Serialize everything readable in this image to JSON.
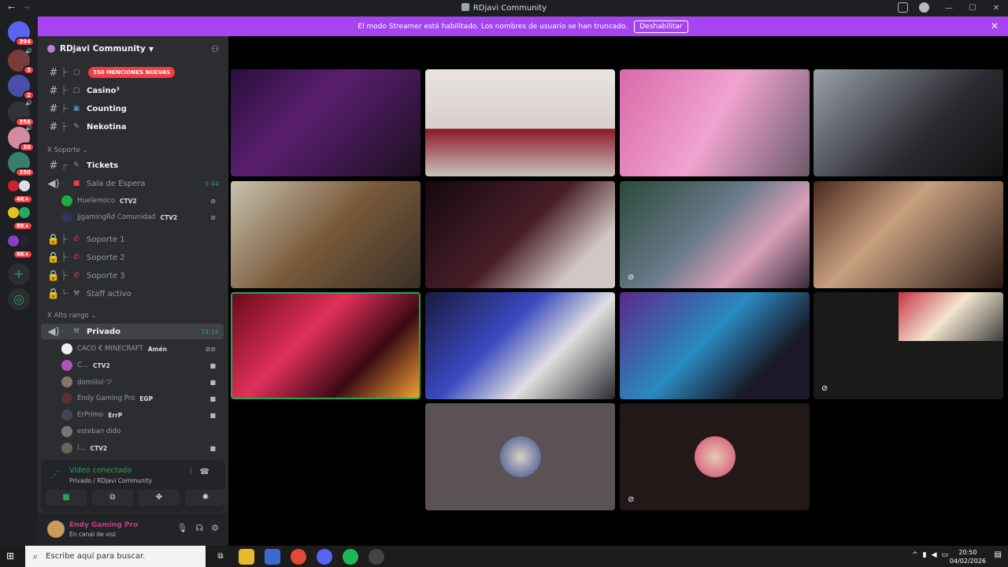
{
  "window": {
    "title": "RDjavi Community"
  },
  "banner": {
    "message": "El modo Streamer está habilitado. Los nombres de usuario se han truncado.",
    "button": "Deshabilitar"
  },
  "servers": {
    "home_badge": "394",
    "items": [
      {
        "badge": "3"
      },
      {
        "badge": "2"
      },
      {
        "badge": "356"
      },
      {
        "badge": "30"
      },
      {
        "badge": "350"
      },
      {
        "badge": "4K+"
      },
      {
        "badge": "8K+"
      },
      {
        "badge": "9K+"
      }
    ]
  },
  "sidebar": {
    "server_name": "RDjavi Community",
    "mentions_pill": "350 MENCIONES NUEVAS",
    "channels": {
      "casino": "Casino³",
      "counting": "Counting",
      "nekotina": "Nekotina",
      "tickets": "Tickets",
      "sala_espera": "Sala de Espera",
      "sala_espera_time": "5:44",
      "soporte1": "Soporte 1",
      "soporte2": "Soporte 2",
      "soporte3": "Soporte 3",
      "staff": "Staff activo",
      "privado": "Privado",
      "privado_time": "14:16"
    },
    "categories": {
      "soporte": "X Soporte",
      "alto": "X Alto rango"
    },
    "sala_users": [
      {
        "name": "Huelemoco",
        "tag": "CTV2"
      },
      {
        "name": "JjgamingRd Comunidad",
        "tag": "CTV2"
      }
    ],
    "privado_users": [
      {
        "name": "CACO € MINECRAFT",
        "tag": "Amén"
      },
      {
        "name": "C...",
        "tag": "CTV2"
      },
      {
        "name": "domiilol·ツ",
        "tag": ""
      },
      {
        "name": "Endy Gaming Pro",
        "tag": "EGP"
      },
      {
        "name": "ErPrimo",
        "tag": "ErrP"
      },
      {
        "name": "esteban dido",
        "tag": ""
      },
      {
        "name": "l...",
        "tag": "CTV2"
      }
    ]
  },
  "voice": {
    "status": "Video conectado",
    "location": "Privado / RDjavi Community"
  },
  "user": {
    "name": "Endy Gaming Pro",
    "status": "En canal de voz"
  },
  "taskbar": {
    "search_placeholder": "Escribe aquí para buscar.",
    "time": "20:50",
    "date": "04/02/2026"
  },
  "colors": {
    "banner": "#a544f0",
    "green": "#23a55a",
    "mention": "#f23f43"
  }
}
